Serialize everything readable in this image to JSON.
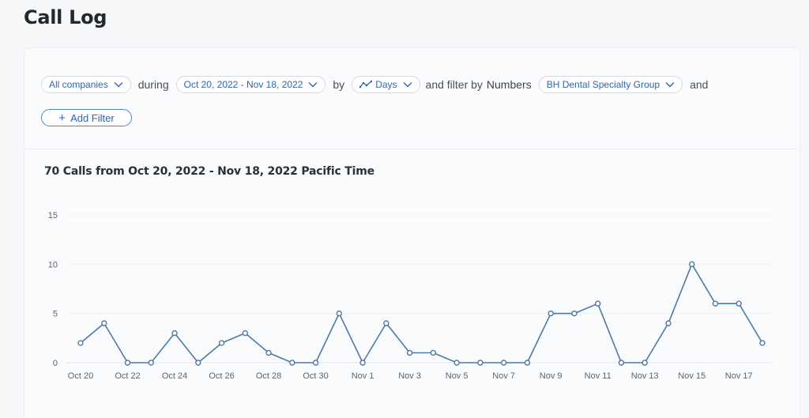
{
  "page": {
    "title": "Call Log"
  },
  "filters": {
    "company": "All companies",
    "during_word": "during",
    "date_range": "Oct 20, 2022 - Nov 18, 2022",
    "by_word": "by",
    "granularity": "Days",
    "filter_by_word": "and filter by",
    "numbers_word": "Numbers",
    "number_group": "BH Dental Specialty Group",
    "and_word": "and",
    "add_filter": "Add Filter"
  },
  "icons": {
    "chevron": "chevron-down-icon",
    "trend": "trend-line-icon",
    "plus": "plus-icon"
  },
  "colors": {
    "accent": "#2f66b3",
    "line": "#4e79a7"
  },
  "chart_data": {
    "type": "line",
    "title": "70 Calls from Oct 20, 2022 - Nov 18, 2022 Pacific Time",
    "xlabel": "",
    "ylabel": "",
    "ylim": [
      0,
      15
    ],
    "yticks": [
      0,
      5,
      10,
      15
    ],
    "grid": true,
    "x": [
      "Oct 20",
      "Oct 21",
      "Oct 22",
      "Oct 23",
      "Oct 24",
      "Oct 25",
      "Oct 26",
      "Oct 27",
      "Oct 28",
      "Oct 29",
      "Oct 30",
      "Oct 31",
      "Nov 1",
      "Nov 2",
      "Nov 3",
      "Nov 4",
      "Nov 5",
      "Nov 6",
      "Nov 7",
      "Nov 8",
      "Nov 9",
      "Nov 10",
      "Nov 11",
      "Nov 12",
      "Nov 13",
      "Nov 14",
      "Nov 15",
      "Nov 16",
      "Nov 17",
      "Nov 18"
    ],
    "xtick_labels": [
      "Oct 20",
      "Oct 22",
      "Oct 24",
      "Oct 26",
      "Oct 28",
      "Oct 30",
      "Nov 1",
      "Nov 3",
      "Nov 5",
      "Nov 7",
      "Nov 9",
      "Nov 11",
      "Nov 13",
      "Nov 15",
      "Nov 17"
    ],
    "values": [
      2,
      4,
      0,
      0,
      3,
      0,
      2,
      3,
      1,
      0,
      0,
      5,
      0,
      4,
      1,
      1,
      0,
      0,
      0,
      0,
      5,
      5,
      6,
      0,
      0,
      4,
      10,
      6,
      6,
      2
    ]
  }
}
